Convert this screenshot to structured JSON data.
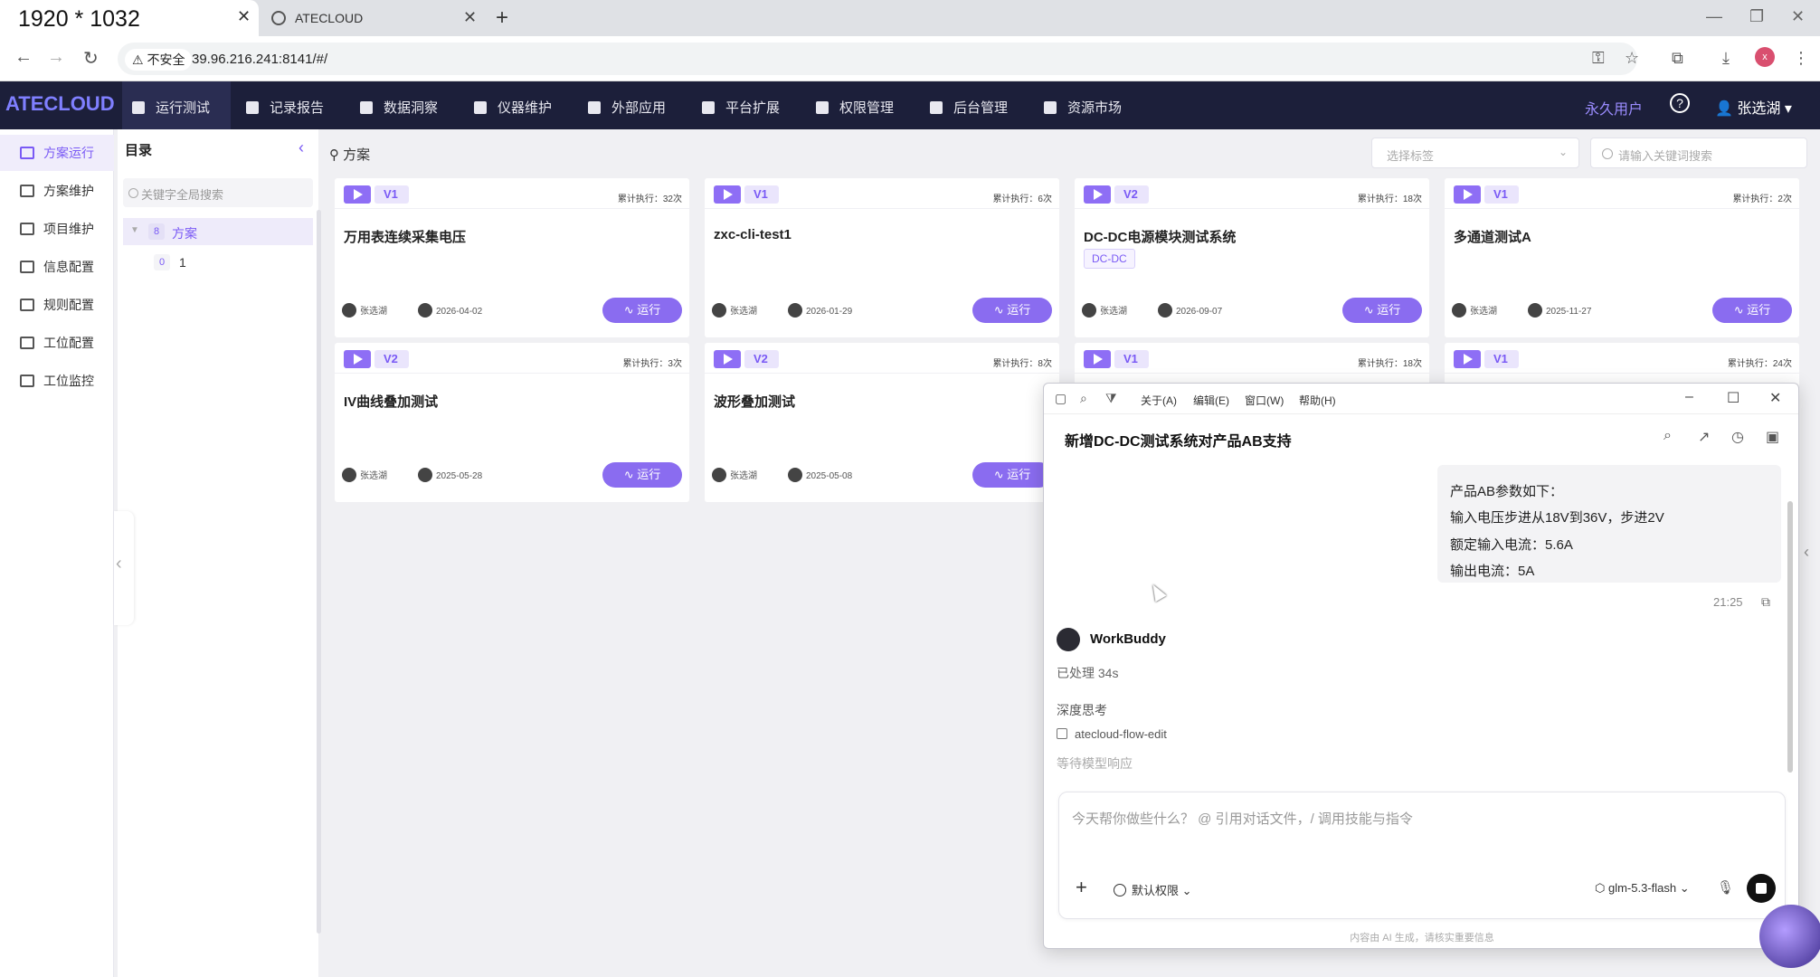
{
  "browser": {
    "active_tab_label": "1920 * 1032",
    "tab2_label": "ATECLOUD",
    "security_label": "不安全",
    "url": "39.96.216.241:8141/#/",
    "profile_initial": "x"
  },
  "app": {
    "logo": "ATECLOUD",
    "nav": [
      "运行测试",
      "记录报告",
      "数据洞察",
      "仪器维护",
      "外部应用",
      "平台扩展",
      "权限管理",
      "后台管理",
      "资源市场"
    ],
    "license": "永久用户",
    "user": "张选湖"
  },
  "left_nav": [
    "方案运行",
    "方案维护",
    "项目维护",
    "信息配置",
    "规则配置",
    "工位配置",
    "工位监控"
  ],
  "directory": {
    "title": "目录",
    "search_placeholder": "关键字全局搜索",
    "root": {
      "count": "8",
      "label": "方案"
    },
    "child": {
      "count": "0",
      "label": "1"
    }
  },
  "main": {
    "breadcrumb": "方案",
    "tag_select_placeholder": "选择标签",
    "search_placeholder": "请输入关键词搜索",
    "run_label": "运行",
    "cards": [
      {
        "version": "V1",
        "count": "累计执行：32次",
        "name": "万用表连续采集电压",
        "tag": "",
        "owner": "张选湖",
        "date": "2026-04-02"
      },
      {
        "version": "V1",
        "count": "累计执行：6次",
        "name": "zxc-cli-test1",
        "tag": "",
        "owner": "张选湖",
        "date": "2026-01-29"
      },
      {
        "version": "V2",
        "count": "累计执行：18次",
        "name": "DC-DC电源模块测试系统",
        "tag": "DC-DC",
        "owner": "张选湖",
        "date": "2026-09-07"
      },
      {
        "version": "V1",
        "count": "累计执行：2次",
        "name": "多通道测试A",
        "tag": "",
        "owner": "张选湖",
        "date": "2025-11-27"
      },
      {
        "version": "V2",
        "count": "累计执行：3次",
        "name": "IV曲线叠加测试",
        "tag": "",
        "owner": "张选湖",
        "date": "2025-05-28"
      },
      {
        "version": "V2",
        "count": "累计执行：8次",
        "name": "波形叠加测试",
        "tag": "",
        "owner": "张选湖",
        "date": "2025-05-08"
      },
      {
        "version": "V1",
        "count": "累计执行：18次",
        "name": "",
        "tag": "",
        "owner": "",
        "date": ""
      },
      {
        "version": "V1",
        "count": "累计执行：24次",
        "name": "",
        "tag": "",
        "owner": "",
        "date": ""
      }
    ]
  },
  "chat": {
    "menus": [
      "关于(A)",
      "编辑(E)",
      "窗口(W)",
      "帮助(H)"
    ],
    "title": "新增DC-DC测试系统对产品AB支持",
    "user_message_lines": [
      "产品AB参数如下：",
      "输入电压步进从18V到36V，步进2V",
      "额定输入电流：5.6A",
      "输出电流：5A"
    ],
    "time": "21:25",
    "assistant_name": "WorkBuddy",
    "processed": "已处理 34s",
    "deep_thinking": "深度思考",
    "skill": "atecloud-flow-edit",
    "waiting": "等待模型响应",
    "input_placeholder": "今天帮你做些什么？ @ 引用对话文件，/ 调用技能与指令",
    "permission": "默认权限",
    "model": "glm-5.3-flash",
    "disclaimer": "内容由 AI 生成，请核实重要信息"
  }
}
